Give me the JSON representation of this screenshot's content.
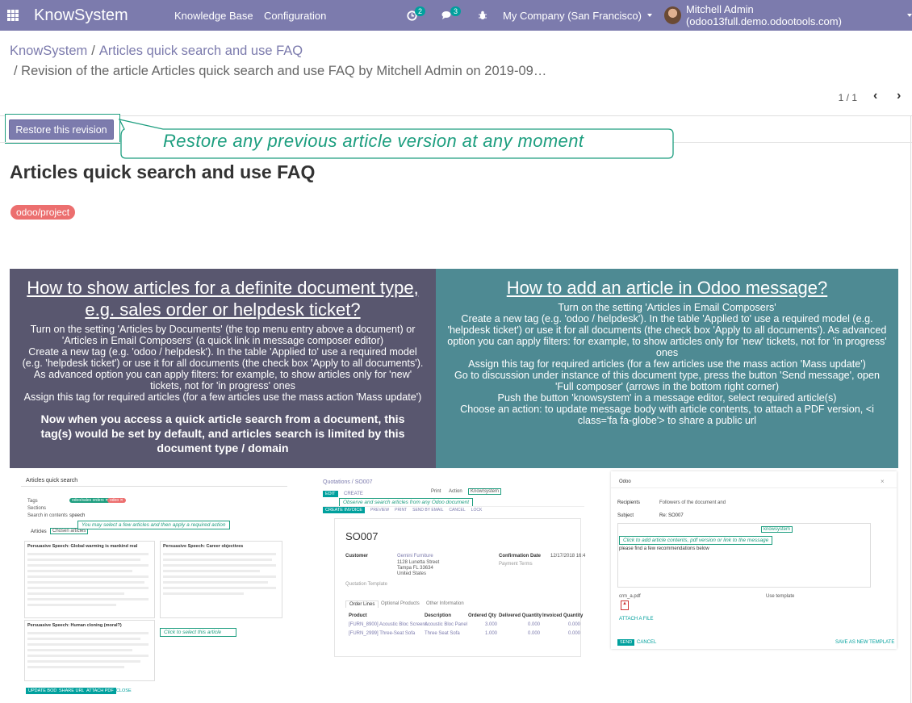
{
  "navbar": {
    "brand": "KnowSystem",
    "menu": [
      "Knowledge Base",
      "Configuration"
    ],
    "activity_count": "2",
    "messages_count": "3",
    "company": "My Company (San Francisco)",
    "user": "Mitchell Admin (odoo13full.demo.odootools.com)"
  },
  "breadcrumb": {
    "root": "KnowSystem",
    "article": "Articles quick search and use FAQ",
    "revision": "/ Revision of the article Articles quick search and use FAQ by Mitchell Admin on 2019-09…"
  },
  "pager": {
    "value": "1 / 1"
  },
  "restore_button": "Restore this revision",
  "callout": "Restore any previous article version at any moment",
  "article": {
    "title": "Articles quick search and use FAQ",
    "tag": "odoo/project"
  },
  "panel_left": {
    "heading": "How to show articles for a definite document type, e.g. sales order or helpdesk ticket?",
    "lines": [
      "Turn on the setting 'Articles by Documents' (the top menu entry above a document) or 'Articles in Email Composers' (a quick link in message composer editor)",
      "Create a new tag (e.g. 'odoo / helpdesk'). In the table 'Applied to' use a required model (e.g. 'helpdesk ticket') or use it for all documents (the check box 'Apply to all documents').",
      "As advanced option you can apply filters: for example, to show articles only for 'new' tickets, not for 'in progress' ones",
      "Assign this tag for required articles (for a few articles use the mass action 'Mass update')"
    ],
    "emphasis": "Now when you access a quick article search from a document, this tag(s) would be set by default, and articles search is limited by this document type / domain"
  },
  "panel_right": {
    "heading": "How to add an article in Odoo message?",
    "lines": [
      "Turn on the setting 'Articles in Email Composers'",
      "Create a new tag (e.g. 'odoo / helpdesk'). In the table 'Applied to' use a required model (e.g. 'helpdesk ticket') or use it for all documents (the check box 'Apply to all documents'). As advanced option you can apply filters: for example, to show articles only for 'new' tickets, not for 'in progress' ones",
      "Assign this tag for required articles (for a few articles use the mass action 'Mass update')",
      "Go to discussion under instance of this document type, press the button 'Send message', open 'Full composer' (arrows in the bottom right corner)",
      "Push the button 'knowsystem' in a message editor, select required article(s)",
      "Choose an action: to update message body with article contents, to attach a PDF version, <i class='fa fa-globe'> to share a public url"
    ]
  },
  "shot1": {
    "title": "Articles quick search",
    "fields": [
      "Tags",
      "Sections",
      "Search in contents"
    ],
    "search_value": "speech",
    "tabs": [
      "Articles",
      "Chosen articles"
    ],
    "note_select": "You may select a few articles and then apply a required action",
    "cards": [
      "Persuasive Speech: Global warming is mankind real",
      "Persuasive Speech: Career objectives",
      "Persuasive Speech: Human cloning (moral?)"
    ],
    "note_click": "Click to select this article",
    "buttons": [
      "UPDATE BODY",
      "SHARE URL",
      "ATTACH PDF",
      "CLOSE"
    ]
  },
  "shot2": {
    "breadcrumb": "Quotations / SO007",
    "actions": [
      "Print",
      "Action",
      "KnowSystem"
    ],
    "buttons": [
      "EDIT",
      "CREATE"
    ],
    "toolbar": [
      "CREATE INVOICE",
      "PREVIEW",
      "PRINT",
      "SEND BY EMAIL",
      "CANCEL",
      "LOCK"
    ],
    "note": "Observe and search articles from any Odoo document",
    "doc": "SO007",
    "customer_label": "Customer",
    "customer": "Gemini Furniture",
    "address": [
      "1128 Lunetta Street",
      "Tampa FL 33634",
      "United States"
    ],
    "confirmation_label": "Confirmation Date",
    "confirmation_date": "12/17/2018 16:4",
    "payment_label": "Payment Terms",
    "template_label": "Quotation Template",
    "tabs": [
      "Order Lines",
      "Optional Products",
      "Other Information"
    ],
    "columns": [
      "Product",
      "Description",
      "Ordered Qty",
      "Delivered Quantity",
      "Invoiced Quantity"
    ],
    "rows": [
      [
        "[FURN_8900] Acoustic Bloc Screens",
        "Acoustic Bloc Panel",
        "3.000",
        "0.000",
        "0.000"
      ],
      [
        "[FURN_2999] Three-Seat Sofa",
        "Three Seat Sofa",
        "1.000",
        "0.000",
        "0.000"
      ]
    ]
  },
  "shot3": {
    "title": "Odoo",
    "recipients_label": "Recipients",
    "recipients_value": "Followers of the document and",
    "subject_label": "Subject",
    "subject_value": "Re: SO007",
    "knowsystem_btn": "knowsystem",
    "note": "Click to add article contents, pdf version or link to the message",
    "body_text": "please find a few recommendations below",
    "file_name": "crm_a.pdf",
    "template_label": "Use template",
    "attach_label": "ATTACH A FILE",
    "send": "SEND",
    "cancel": "CANCEL",
    "save_template": "SAVE AS NEW TEMPLATE"
  },
  "colors": {
    "navbar": "#7c7bad",
    "panel_left": "#59576f",
    "panel_right": "#4e8a93",
    "callout": "#1d9e7f",
    "tag": "#ec6f6f"
  }
}
